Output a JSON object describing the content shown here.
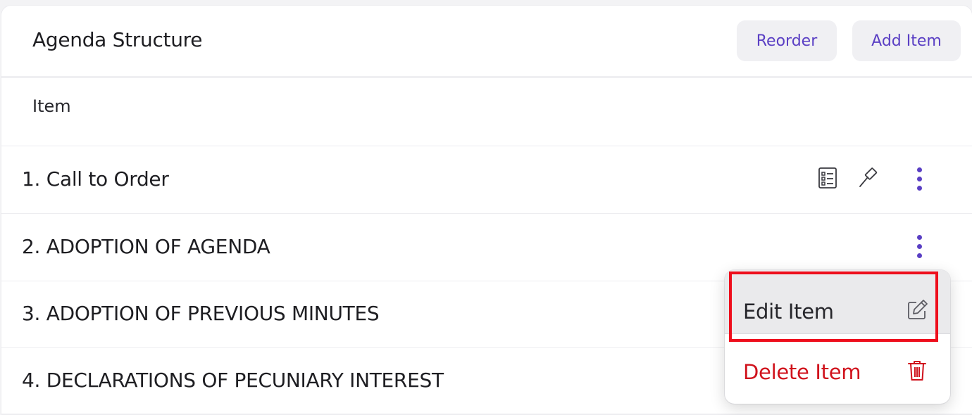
{
  "panel": {
    "title": "Agenda Structure",
    "reorder_label": "Reorder",
    "add_item_label": "Add Item"
  },
  "table": {
    "column_header": "Item",
    "rows": [
      {
        "label": "1. Call to Order",
        "icons": [
          "checklist-icon",
          "gavel-icon",
          "more-vertical-icon"
        ]
      },
      {
        "label": "2. ADOPTION OF AGENDA",
        "icons": [
          "more-vertical-icon"
        ]
      },
      {
        "label": "3. ADOPTION OF PREVIOUS MINUTES",
        "icons": []
      },
      {
        "label": "4. DECLARATIONS OF PECUNIARY INTEREST",
        "icons": []
      }
    ]
  },
  "context_menu": {
    "edit_label": "Edit Item",
    "edit_icon": "edit-icon",
    "delete_label": "Delete Item",
    "delete_icon": "trash-icon"
  },
  "colors": {
    "accent": "#5a3fc4",
    "danger": "#d0121c",
    "highlight_border": "#ee0e1c"
  }
}
